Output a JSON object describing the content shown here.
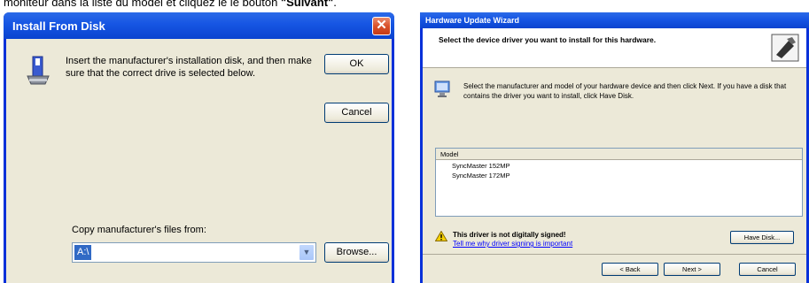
{
  "caption": {
    "text": "moniteur dans la liste du model et cliquez le le bouton ",
    "bold": "\"Suivant\"",
    "end": "."
  },
  "install_dialog": {
    "title": "Install From Disk",
    "message": "Insert the manufacturer's installation disk, and then make sure that the correct drive is selected below.",
    "ok_label": "OK",
    "cancel_label": "Cancel",
    "copy_label": "Copy manufacturer's files from:",
    "path_value": "A:\\",
    "browse_label": "Browse..."
  },
  "wizard": {
    "title": "Hardware Update Wizard",
    "heading": "Select the device driver you want to install for this hardware.",
    "instructions": "Select the manufacturer and model of your hardware device and then click Next. If you have a disk that contains the driver you want to install, click Have Disk.",
    "model_header": "Model",
    "models": [
      "SyncMaster 152MP",
      "SyncMaster 172MP"
    ],
    "warning_title": "This driver is not digitally signed!",
    "warning_link": "Tell me why driver signing is important",
    "have_disk_label": "Have Disk...",
    "back_label": "< Back",
    "next_label": "Next >",
    "cancel_label": "Cancel"
  },
  "colors": {
    "titlebar": "#0a43cf",
    "dialog_face": "#ece9d8",
    "close_button": "#d9512a",
    "selection": "#316ac5",
    "link": "#0000ff"
  },
  "icons": [
    "disk-icon",
    "close-icon",
    "chevron-down-icon",
    "wizard-icon",
    "monitor-icon",
    "warning-icon"
  ]
}
